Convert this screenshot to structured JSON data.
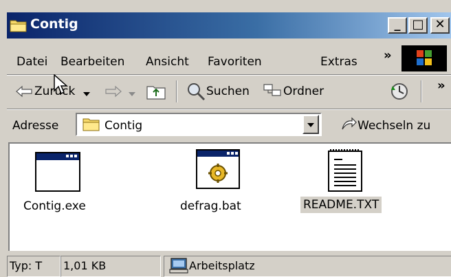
{
  "window": {
    "title": "Contig"
  },
  "caption_buttons": {
    "minimize": "_",
    "maximize": "□",
    "close": "✕"
  },
  "menu": {
    "items": [
      "Datei",
      "Bearbeiten",
      "Ansicht",
      "Favoriten",
      "Extras"
    ],
    "overflow": "»"
  },
  "toolbar": {
    "back_label": "Zurück",
    "search_label": "Suchen",
    "folders_label": "Ordner",
    "overflow": "»"
  },
  "address": {
    "label": "Adresse",
    "value": "Contig",
    "go_label": "Wechseln zu"
  },
  "files": [
    {
      "name": "Contig.exe",
      "icon": "application-window-icon"
    },
    {
      "name": "defrag.bat",
      "icon": "batch-file-icon"
    },
    {
      "name": "README.TXT",
      "icon": "text-document-icon",
      "selected": true
    }
  ],
  "status": {
    "type_text": "Typ: T",
    "size_text": "1,01 KB",
    "location_text": "Arbeitsplatz"
  },
  "colors": {
    "titlebar_start": "#0a246a",
    "titlebar_end": "#a6caf0",
    "chrome": "#d4d0c8",
    "selection": "#d4d0c8"
  }
}
